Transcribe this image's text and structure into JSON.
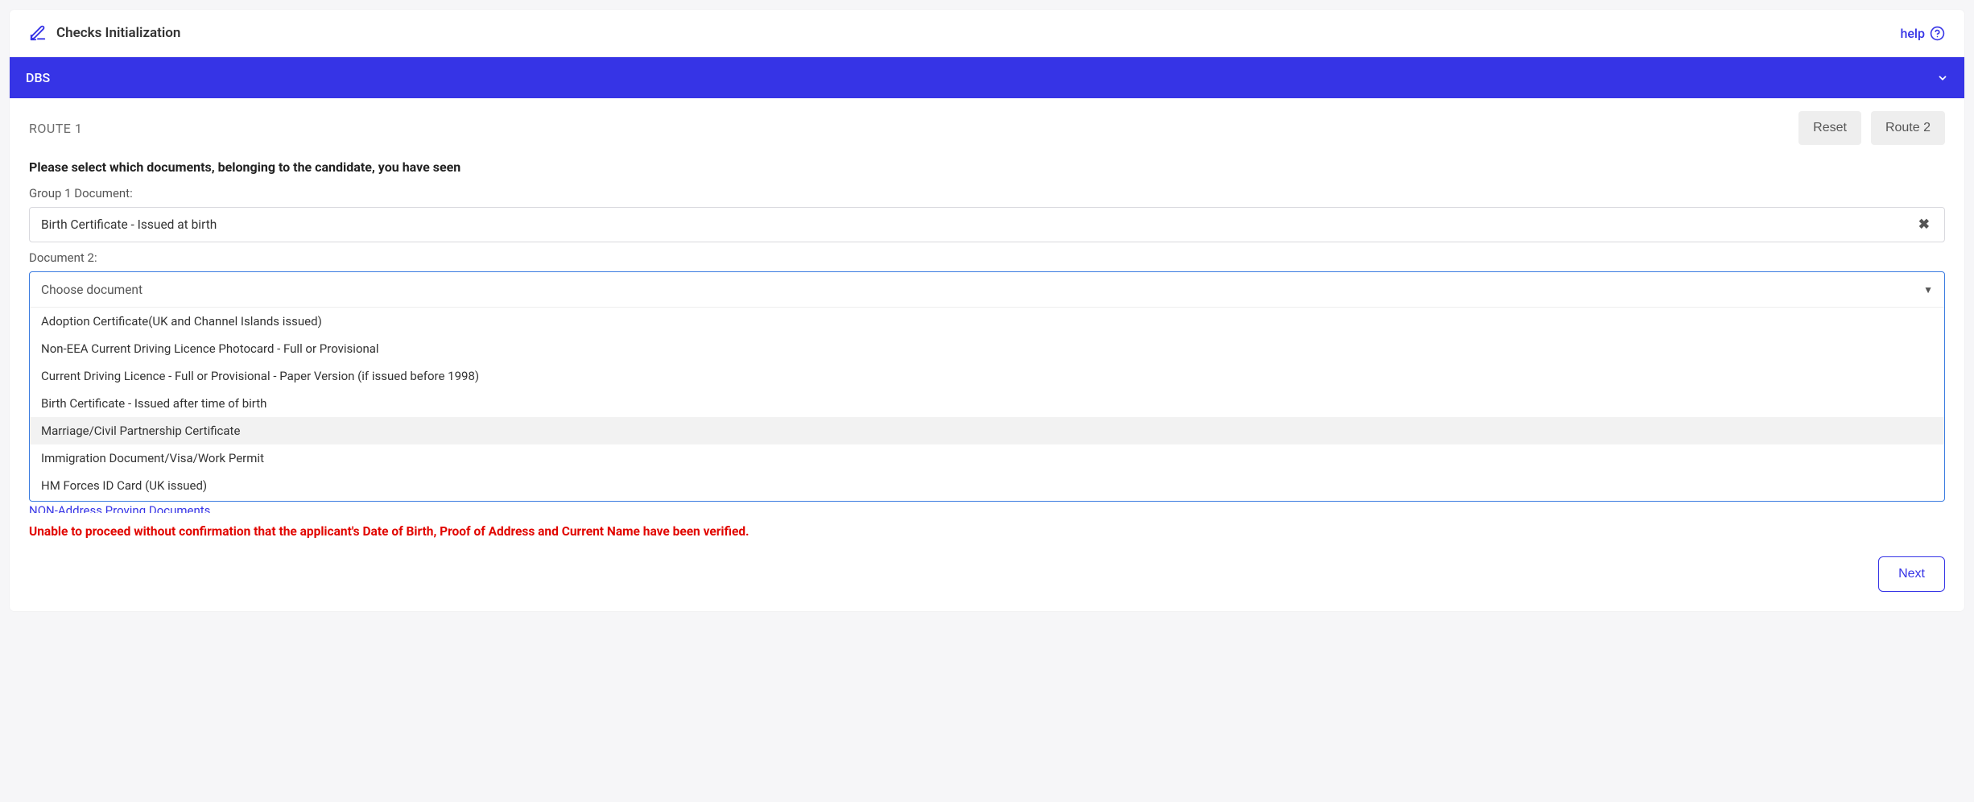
{
  "header": {
    "title": "Checks Initialization",
    "help_label": "help"
  },
  "section": {
    "title": "DBS"
  },
  "route": {
    "label": "ROUTE 1",
    "reset_label": "Reset",
    "route2_label": "Route 2"
  },
  "instruction": "Please select which documents, belonging to the candidate, you have seen",
  "group1": {
    "label": "Group 1 Document:",
    "value": "Birth Certificate - Issued at birth"
  },
  "doc2": {
    "label": "Document 2:",
    "placeholder": "Choose document",
    "options": [
      "Adoption Certificate(UK and Channel Islands issued)",
      "Non-EEA Current Driving Licence Photocard - Full or Provisional",
      "Current Driving Licence - Full or Provisional - Paper Version (if issued before 1998)",
      "Birth Certificate - Issued after time of birth",
      "Marriage/Civil Partnership Certificate",
      "Immigration Document/Visa/Work Permit",
      "HM Forces ID Card (UK issued)"
    ],
    "highlight_index": 4
  },
  "covered_link": "NON-Address Proving Documents.",
  "error": "Unable to proceed without confirmation that the applicant's Date of Birth, Proof of Address and Current Name have been verified.",
  "next_label": "Next"
}
